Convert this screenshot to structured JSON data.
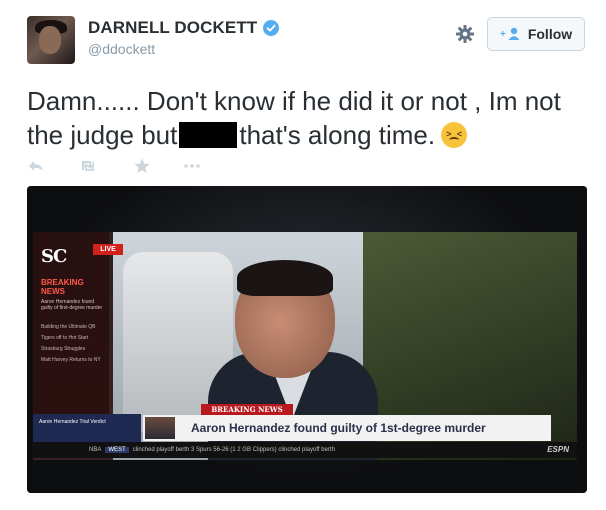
{
  "user": {
    "name": "DARNELL DOCKETT",
    "handle": "@ddockett"
  },
  "follow_button": {
    "label": "Follow"
  },
  "tweet": {
    "text_part1": "Damn...... Don't know if he did it or not , Im not the judge but",
    "text_part2": "that's along time."
  },
  "photo": {
    "logo": "SC",
    "live": "LIVE",
    "breaking_news_side": "BREAKING NEWS",
    "side_sub": "Aaron Hernandez found guilty of first-degree murder",
    "side_items": [
      "Building the Ultimate QB",
      "Tigers off to Hot Start",
      "Strasburg Struggles",
      "Matt Harvey Returns to NY"
    ],
    "lower_left_text": "Aaron Hernandez Trial Verdict",
    "breaking_news_label": "BREAKING NEWS",
    "headline": "Aaron Hernandez found guilty of 1st-degree murder",
    "ticker_league": "NBA",
    "ticker_conf": "WEST",
    "ticker_text": "clinched playoff berth   3 Spurs 56-26 (1 2 GB Clippers) clinched playoff berth",
    "network": "ESPN"
  },
  "colors": {
    "verified": "#55acee",
    "follow_icon": "#55acee",
    "text": "#292f33",
    "muted": "#8899a6",
    "icons": "#ccd6dd"
  }
}
